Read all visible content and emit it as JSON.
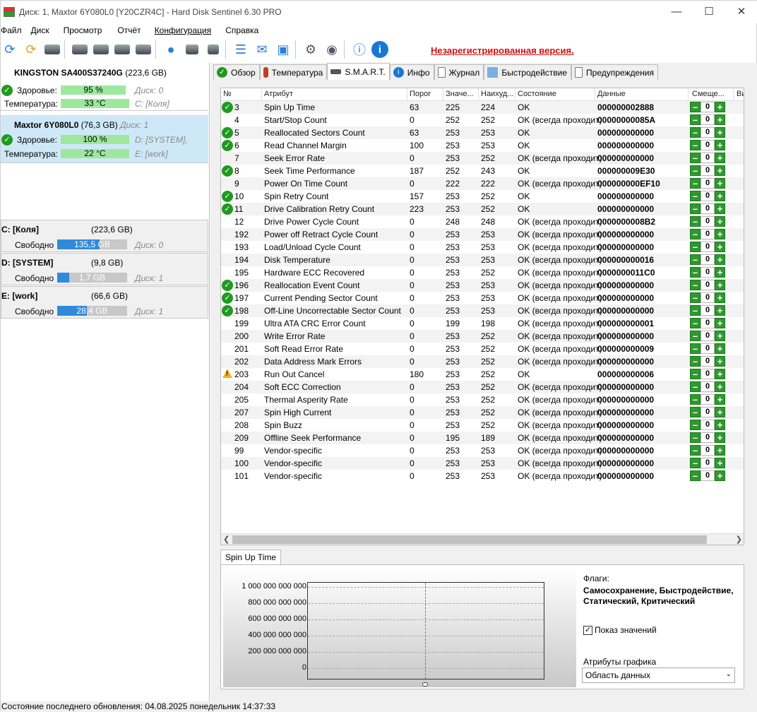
{
  "window": {
    "title": "Диск: 1, Maxtor 6Y080L0 [Y20CZR4C]  -  Hard Disk Sentinel 6.30 PRO"
  },
  "menu": [
    "Файл",
    "Диск",
    "Просмотр",
    "Отчёт",
    "Конфигурация",
    "Справка"
  ],
  "unregistered": "Незарегистрированная версия.",
  "disks": [
    {
      "name": "KINGSTON SA400S37240G",
      "size": "(223,6 GB)",
      "health_label": "Здоровье:",
      "health": "95 %",
      "health_level": 95,
      "health_disk": "Диск: 0",
      "temp_label": "Температура:",
      "temp": "33 °C",
      "temp_vol": "C: [Коля]"
    },
    {
      "name": "Maxtor 6Y080L0",
      "size": "(76,3 GB)",
      "disk_no": "Диск: 1",
      "health_label": "Здоровье:",
      "health": "100 %",
      "health_level": 100,
      "health_vol": "D: [SYSTEM],",
      "temp_label": "Температура:",
      "temp": "22 °C",
      "temp_vol": "E: [work]"
    }
  ],
  "volumes": [
    {
      "name": "C: [Коля]",
      "size": "(223,6 GB)",
      "free_label": "Свободно",
      "free": "135,5 GB",
      "free_pct": 60.6,
      "disk": "Диск: 0"
    },
    {
      "name": "D: [SYSTEM]",
      "size": "(9,8 GB)",
      "free_label": "Свободно",
      "free": "1,7 GB",
      "free_pct": 17.3,
      "disk": "Диск: 1"
    },
    {
      "name": "E: [work]",
      "size": "(66,6 GB)",
      "free_label": "Свободно",
      "free": "28,4 GB",
      "free_pct": 42.6,
      "disk": "Диск: 1"
    }
  ],
  "tabs": [
    "Обзор",
    "Температура",
    "S.M.A.R.T.",
    "Инфо",
    "Журнал",
    "Быстродействие",
    "Предупреждения"
  ],
  "columns": [
    "№",
    "Атрибут",
    "Порог",
    "Значе...",
    "Наихуд...",
    "Состояние",
    "Данные",
    "Смеще...",
    "Ви"
  ],
  "rows": [
    {
      "status": "ok",
      "id": "3",
      "name": "Spin Up Time",
      "thr": "63",
      "val": "225",
      "worst": "224",
      "state": "OK",
      "data": "000000002888",
      "off": "0"
    },
    {
      "status": "",
      "id": "4",
      "name": "Start/Stop Count",
      "thr": "0",
      "val": "252",
      "worst": "252",
      "state": "OK (всегда проходит)",
      "data": "00000000085A",
      "off": "0"
    },
    {
      "status": "ok",
      "id": "5",
      "name": "Reallocated Sectors Count",
      "thr": "63",
      "val": "253",
      "worst": "253",
      "state": "OK",
      "data": "000000000000",
      "off": "0"
    },
    {
      "status": "ok",
      "id": "6",
      "name": "Read Channel Margin",
      "thr": "100",
      "val": "253",
      "worst": "253",
      "state": "OK",
      "data": "000000000000",
      "off": "0"
    },
    {
      "status": "",
      "id": "7",
      "name": "Seek Error Rate",
      "thr": "0",
      "val": "253",
      "worst": "252",
      "state": "OK (всегда проходит)",
      "data": "000000000000",
      "off": "0"
    },
    {
      "status": "ok",
      "id": "8",
      "name": "Seek Time Performance",
      "thr": "187",
      "val": "252",
      "worst": "243",
      "state": "OK",
      "data": "000000009E30",
      "off": "0"
    },
    {
      "status": "",
      "id": "9",
      "name": "Power On Time Count",
      "thr": "0",
      "val": "222",
      "worst": "222",
      "state": "OK (всегда проходит)",
      "data": "000000000EF10",
      "off": "0"
    },
    {
      "status": "ok",
      "id": "10",
      "name": "Spin Retry Count",
      "thr": "157",
      "val": "253",
      "worst": "252",
      "state": "OK",
      "data": "000000000000",
      "off": "0"
    },
    {
      "status": "ok",
      "id": "11",
      "name": "Drive Calibration Retry Count",
      "thr": "223",
      "val": "253",
      "worst": "252",
      "state": "OK",
      "data": "000000000000",
      "off": "0"
    },
    {
      "status": "",
      "id": "12",
      "name": "Drive Power Cycle Count",
      "thr": "0",
      "val": "248",
      "worst": "248",
      "state": "OK (всегда проходит)",
      "data": "0000000008B2",
      "off": "0"
    },
    {
      "status": "",
      "id": "192",
      "name": "Power off Retract Cycle Count",
      "thr": "0",
      "val": "253",
      "worst": "253",
      "state": "OK (всегда проходит)",
      "data": "000000000000",
      "off": "0"
    },
    {
      "status": "",
      "id": "193",
      "name": "Load/Unload Cycle Count",
      "thr": "0",
      "val": "253",
      "worst": "253",
      "state": "OK (всегда проходит)",
      "data": "000000000000",
      "off": "0"
    },
    {
      "status": "",
      "id": "194",
      "name": "Disk Temperature",
      "thr": "0",
      "val": "253",
      "worst": "253",
      "state": "OK (всегда проходит)",
      "data": "000000000016",
      "off": "0"
    },
    {
      "status": "",
      "id": "195",
      "name": "Hardware ECC Recovered",
      "thr": "0",
      "val": "253",
      "worst": "252",
      "state": "OK (всегда проходит)",
      "data": "0000000011C0",
      "off": "0"
    },
    {
      "status": "ok",
      "id": "196",
      "name": "Reallocation Event Count",
      "thr": "0",
      "val": "253",
      "worst": "253",
      "state": "OK (всегда проходит)",
      "data": "000000000000",
      "off": "0"
    },
    {
      "status": "ok",
      "id": "197",
      "name": "Current Pending Sector Count",
      "thr": "0",
      "val": "253",
      "worst": "253",
      "state": "OK (всегда проходит)",
      "data": "000000000000",
      "off": "0"
    },
    {
      "status": "ok",
      "id": "198",
      "name": "Off-Line Uncorrectable Sector Count",
      "thr": "0",
      "val": "253",
      "worst": "253",
      "state": "OK (всегда проходит)",
      "data": "000000000000",
      "off": "0"
    },
    {
      "status": "",
      "id": "199",
      "name": "Ultra ATA CRC Error Count",
      "thr": "0",
      "val": "199",
      "worst": "198",
      "state": "OK (всегда проходит)",
      "data": "000000000001",
      "off": "0"
    },
    {
      "status": "",
      "id": "200",
      "name": "Write Error Rate",
      "thr": "0",
      "val": "253",
      "worst": "252",
      "state": "OK (всегда проходит)",
      "data": "000000000000",
      "off": "0"
    },
    {
      "status": "",
      "id": "201",
      "name": "Soft Read Error Rate",
      "thr": "0",
      "val": "253",
      "worst": "252",
      "state": "OK (всегда проходит)",
      "data": "000000000009",
      "off": "0"
    },
    {
      "status": "",
      "id": "202",
      "name": "Data Address Mark Errors",
      "thr": "0",
      "val": "253",
      "worst": "252",
      "state": "OK (всегда проходит)",
      "data": "000000000000",
      "off": "0"
    },
    {
      "status": "warn",
      "id": "203",
      "name": "Run Out Cancel",
      "thr": "180",
      "val": "253",
      "worst": "252",
      "state": "OK",
      "data": "000000000006",
      "off": "0"
    },
    {
      "status": "",
      "id": "204",
      "name": "Soft ECC Correction",
      "thr": "0",
      "val": "253",
      "worst": "252",
      "state": "OK (всегда проходит)",
      "data": "000000000000",
      "off": "0"
    },
    {
      "status": "",
      "id": "205",
      "name": "Thermal Asperity Rate",
      "thr": "0",
      "val": "253",
      "worst": "252",
      "state": "OK (всегда проходит)",
      "data": "000000000000",
      "off": "0"
    },
    {
      "status": "",
      "id": "207",
      "name": "Spin High Current",
      "thr": "0",
      "val": "253",
      "worst": "252",
      "state": "OK (всегда проходит)",
      "data": "000000000000",
      "off": "0"
    },
    {
      "status": "",
      "id": "208",
      "name": "Spin Buzz",
      "thr": "0",
      "val": "253",
      "worst": "252",
      "state": "OK (всегда проходит)",
      "data": "000000000000",
      "off": "0"
    },
    {
      "status": "",
      "id": "209",
      "name": "Offline Seek Performance",
      "thr": "0",
      "val": "195",
      "worst": "189",
      "state": "OK (всегда проходит)",
      "data": "000000000000",
      "off": "0"
    },
    {
      "status": "",
      "id": "99",
      "name": "Vendor-specific",
      "thr": "0",
      "val": "253",
      "worst": "253",
      "state": "OK (всегда проходит)",
      "data": "000000000000",
      "off": "0"
    },
    {
      "status": "",
      "id": "100",
      "name": "Vendor-specific",
      "thr": "0",
      "val": "253",
      "worst": "253",
      "state": "OK (всегда проходит)",
      "data": "000000000000",
      "off": "0"
    },
    {
      "status": "",
      "id": "101",
      "name": "Vendor-specific",
      "thr": "0",
      "val": "253",
      "worst": "253",
      "state": "OK (всегда проходит)",
      "data": "000000000000",
      "off": "0"
    }
  ],
  "graph": {
    "tab": "Spin Up Time",
    "yticks": [
      "1 000 000 000 000",
      "800 000 000 000",
      "600 000 000 000",
      "400 000 000 000",
      "200 000 000 000",
      "0"
    ],
    "flags_label": "Флаги:",
    "flags": "Самосохранение, Быстродействие, Статический, Критический",
    "show_values": "Показ значений",
    "show_values_checked": true,
    "attr_label": "Атрибуты графика",
    "attr_select": "Область данных"
  },
  "statusbar": "Состояние последнего обновления: 04.08.2025 понедельник 14:37:33"
}
